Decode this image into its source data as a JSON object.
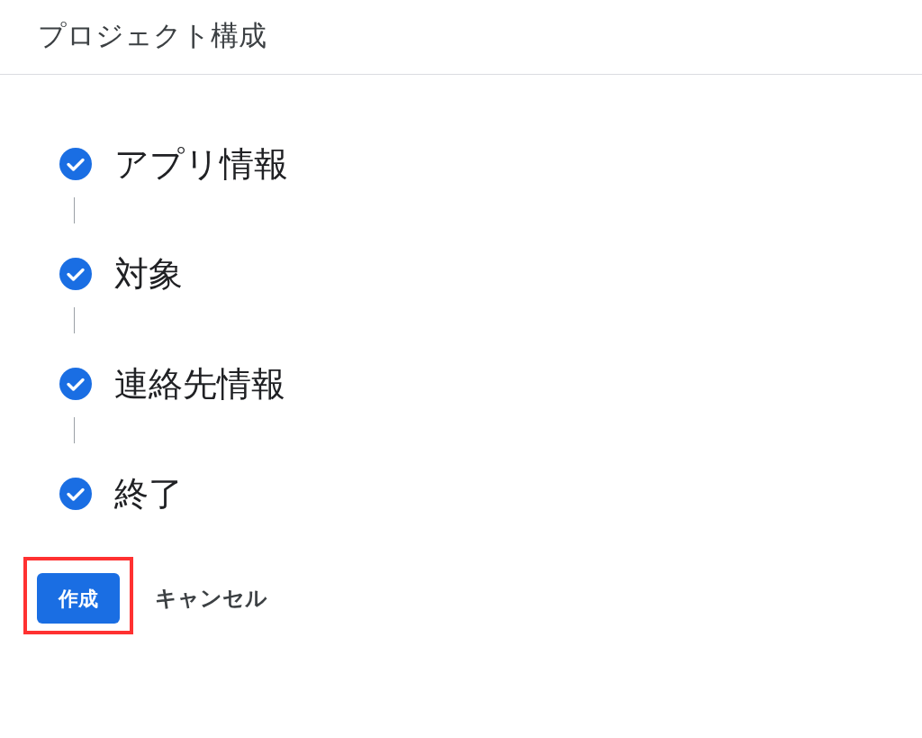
{
  "header": {
    "title": "プロジェクト構成"
  },
  "steps": [
    {
      "label": "アプリ情報",
      "completed": true
    },
    {
      "label": "対象",
      "completed": true
    },
    {
      "label": "連絡先情報",
      "completed": true
    },
    {
      "label": "終了",
      "completed": true
    }
  ],
  "actions": [
    {
      "kind": "primary",
      "label": "作成",
      "highlighted": true
    },
    {
      "kind": "text",
      "label": "キャンセル",
      "highlighted": false
    }
  ]
}
